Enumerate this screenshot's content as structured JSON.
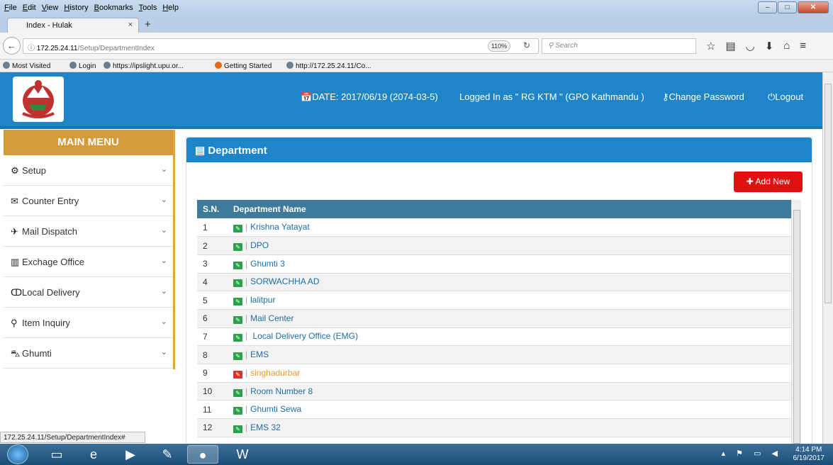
{
  "browser": {
    "menu": [
      "File",
      "Edit",
      "View",
      "History",
      "Bookmarks",
      "Tools",
      "Help"
    ],
    "tab_title": "Index - Hulak",
    "url_host": "172.25.24.11",
    "url_path": "/Setup/DepartmentIndex",
    "zoom": "110%",
    "search_placeholder": "Search",
    "bookmarks": [
      "Most Visited",
      "Login",
      "https://ipslight.upu.or...",
      "Getting Started",
      "http://172.25.24.11/Co..."
    ],
    "status_url": "172.25.24.11/Setup/DepartmentIndex#"
  },
  "header": {
    "date": "DATE: 2017/06/19 (2074-03-5)",
    "user": "Logged In as \" RG KTM \" (GPO Kathmandu )",
    "change_password": "Change Password",
    "logout": "Logout"
  },
  "sidebar": {
    "title": "MAIN MENU",
    "items": [
      {
        "label": "Setup",
        "icon": "gears-icon"
      },
      {
        "label": "Counter Entry",
        "icon": "envelope-icon"
      },
      {
        "label": "Mail Dispatch",
        "icon": "plane-icon"
      },
      {
        "label": "Exchage Office",
        "icon": "briefcase-icon"
      },
      {
        "label": "Local Delivery",
        "icon": "bicycle-icon"
      },
      {
        "label": "Item Inquiry",
        "icon": "search-icon"
      },
      {
        "label": "Ghumti",
        "icon": "car-icon"
      }
    ]
  },
  "panel": {
    "title": "Department",
    "add_button": "Add New",
    "columns": [
      "S.N.",
      "Department Name"
    ],
    "rows": [
      {
        "sn": "1",
        "name": "Krishna Yatayat"
      },
      {
        "sn": "2",
        "name": "DPO"
      },
      {
        "sn": "3",
        "name": "Ghumti 3"
      },
      {
        "sn": "4",
        "name": "SORWACHHA AD"
      },
      {
        "sn": "5",
        "name": "lalitpur"
      },
      {
        "sn": "6",
        "name": "Mail Center"
      },
      {
        "sn": "7",
        "name": " Local Delivery Office (EMG)"
      },
      {
        "sn": "8",
        "name": "EMS"
      },
      {
        "sn": "9",
        "name": "singhadurbar"
      },
      {
        "sn": "10",
        "name": "Room Number 8"
      },
      {
        "sn": "11",
        "name": "Ghumti Sewa"
      },
      {
        "sn": "12",
        "name": "EMS 32"
      }
    ]
  },
  "taskbar": {
    "time": "4:14 PM",
    "date": "6/19/2017"
  },
  "colors": {
    "header_blue": "#1e86c8",
    "menu_orange": "#d59a3a",
    "table_head": "#3e7b9a",
    "add_red": "#e01111"
  }
}
